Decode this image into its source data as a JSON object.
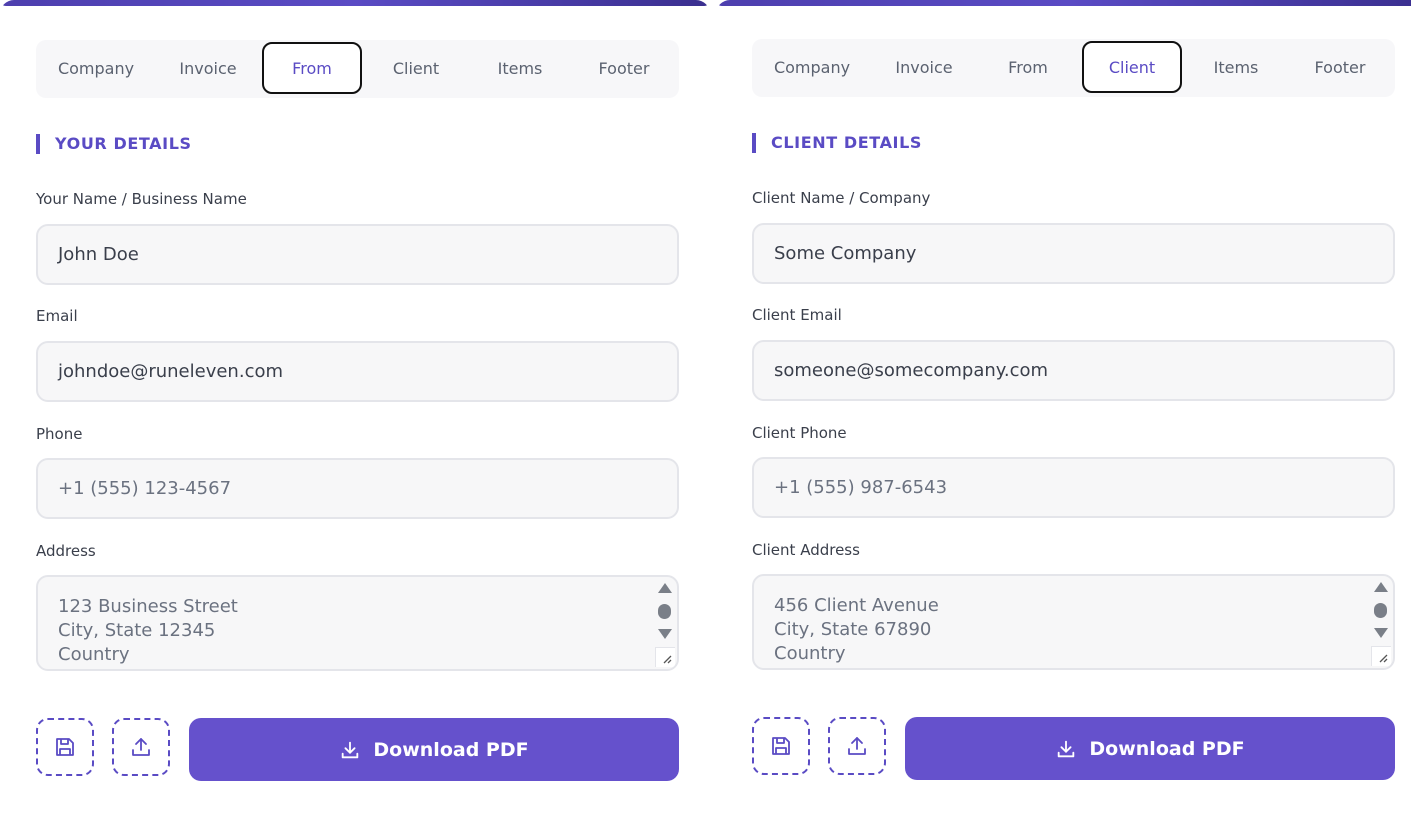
{
  "left_panel": {
    "tabs": [
      "Company",
      "Invoice",
      "From",
      "Client",
      "Items",
      "Footer"
    ],
    "active_tab": "From",
    "section_title": "YOUR DETAILS",
    "fields": {
      "name_label": "Your Name / Business Name",
      "name_value": "John Doe",
      "email_label": "Email",
      "email_value": "johndoe@runeleven.com",
      "phone_label": "Phone",
      "phone_value": "+1 (555) 123-4567",
      "address_label": "Address",
      "address_lines": [
        "123 Business Street",
        "City, State 12345",
        "Country"
      ]
    },
    "download_label": "Download PDF"
  },
  "right_panel": {
    "tabs": [
      "Company",
      "Invoice",
      "From",
      "Client",
      "Items",
      "Footer"
    ],
    "active_tab": "Client",
    "section_title": "CLIENT DETAILS",
    "fields": {
      "name_label": "Client Name / Company",
      "name_value": "Some Company",
      "email_label": "Client Email",
      "email_value": "someone@somecompany.com",
      "phone_label": "Client Phone",
      "phone_value": "+1 (555) 987-6543",
      "address_label": "Client Address",
      "address_lines": [
        "456 Client Avenue",
        "City, State 67890",
        "Country"
      ]
    },
    "download_label": "Download PDF"
  },
  "icons": {
    "save": "save-icon",
    "upload": "upload-icon",
    "download": "download-icon"
  },
  "colors": {
    "accent": "#5a4bc4",
    "button": "#6551cc",
    "field_bg": "#f7f7f8",
    "field_border": "#e4e5ea"
  }
}
